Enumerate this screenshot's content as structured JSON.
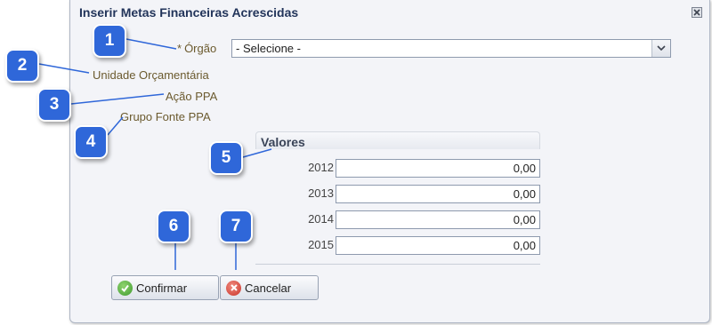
{
  "dialog": {
    "title": "Inserir Metas Financeiras Acrescidas"
  },
  "form": {
    "required_marker": "*",
    "orgao_label": "Órgão",
    "orgao_value": "- Selecione -",
    "unidade_label": "Unidade Orçamentária",
    "acao_label": "Ação PPA",
    "grupo_label": "Grupo Fonte PPA"
  },
  "valores": {
    "title": "Valores",
    "rows": [
      {
        "year": "2012",
        "value": "0,00"
      },
      {
        "year": "2013",
        "value": "0,00"
      },
      {
        "year": "2014",
        "value": "0,00"
      },
      {
        "year": "2015",
        "value": "0,00"
      }
    ]
  },
  "buttons": {
    "confirm": "Confirmar",
    "cancel": "Cancelar"
  },
  "callouts": [
    "1",
    "2",
    "3",
    "4",
    "5",
    "6",
    "7"
  ],
  "colors": {
    "callout": "#2f67d9",
    "title": "#22345a",
    "label": "#6b5a2e",
    "confirm_icon": "#4aa63a",
    "cancel_icon": "#d9453b"
  }
}
